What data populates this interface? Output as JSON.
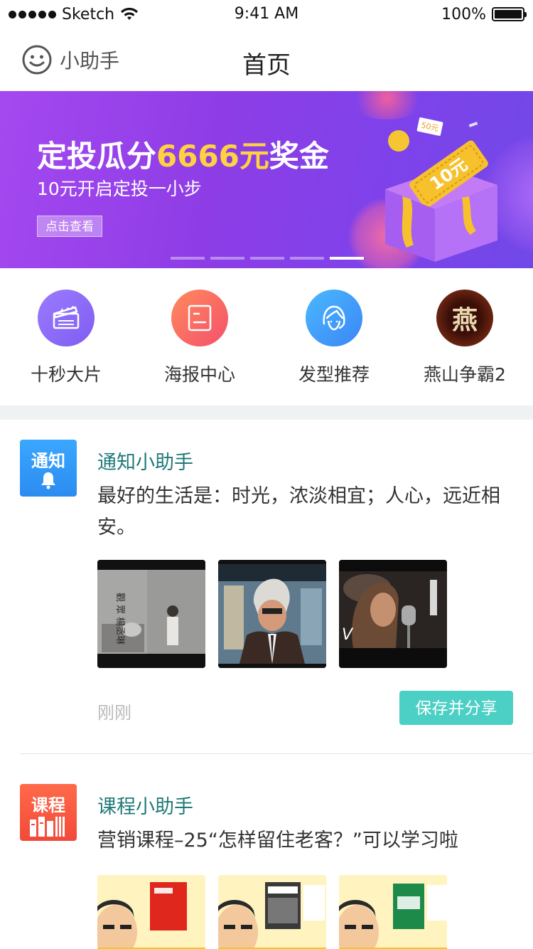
{
  "status_bar": {
    "carrier": "Sketch",
    "time": "9:41 AM",
    "battery": "100%",
    "battery_level": 1.0
  },
  "nav": {
    "left_label": "小助手",
    "title": "首页"
  },
  "banner": {
    "title_prefix": "定投瓜分",
    "title_highlight": "6666元",
    "title_suffix": "奖金",
    "subtitle": "10元开启定投一小步",
    "button": "点击查看",
    "ticket_text": "10元",
    "coupon_text": "50元",
    "pages": 5,
    "active_page": 5
  },
  "quick_actions": [
    {
      "label": "十秒大片",
      "icon": "clapperboard-icon"
    },
    {
      "label": "海报中心",
      "icon": "poster-icon"
    },
    {
      "label": "发型推荐",
      "icon": "hairstyle-icon"
    },
    {
      "label": "燕山争霸2",
      "icon": "game-emblem-icon",
      "emblem": "燕"
    }
  ],
  "feed": [
    {
      "avatar_text": "通知",
      "name": "通知小助手",
      "text": "最好的生活是：时光，浓淡相宜；人心，远近相安。",
      "time": "刚刚",
      "action": "保存并分享",
      "thumb_caption": "觀 眾 楊丞琳"
    },
    {
      "avatar_text": "课程",
      "name": "课程小助手",
      "text": "营销课程–25“怎样留住老客？”可以学习啦"
    }
  ],
  "colors": {
    "accent": "#4ccfc4",
    "banner_purple": "#8e3de6",
    "highlight": "#ffd23f",
    "name_teal": "#1f7a78"
  }
}
